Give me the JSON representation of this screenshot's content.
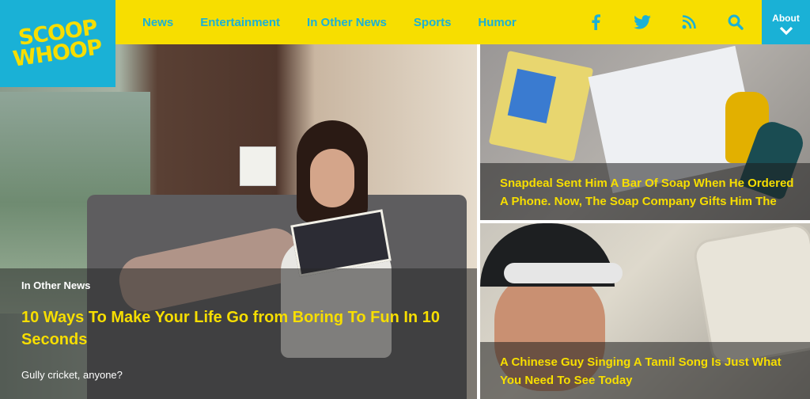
{
  "header": {
    "logo_line1": "SCOOP",
    "logo_line2": "WHOOP",
    "nav": [
      {
        "label": "News"
      },
      {
        "label": "Entertainment"
      },
      {
        "label": "In Other News"
      },
      {
        "label": "Sports"
      },
      {
        "label": "Humor"
      }
    ],
    "social_icons": [
      "facebook-icon",
      "twitter-icon",
      "rss-icon",
      "search-icon"
    ],
    "about_label": "About",
    "colors": {
      "yellow": "#f7de00",
      "blue": "#1ab1d6"
    }
  },
  "main_story": {
    "category": "In Other News",
    "title": "10 Ways To Make Your Life Go from Boring To Fun In 10 Seconds",
    "subtitle": "Gully cricket, anyone?"
  },
  "side_stories": [
    {
      "title": "Snapdeal Sent Him A Bar Of Soap When He Ordered A Phone. Now, The Soap Company Gifts Him The"
    },
    {
      "title": "A Chinese Guy Singing A Tamil Song Is Just What You Need To See Today"
    }
  ]
}
